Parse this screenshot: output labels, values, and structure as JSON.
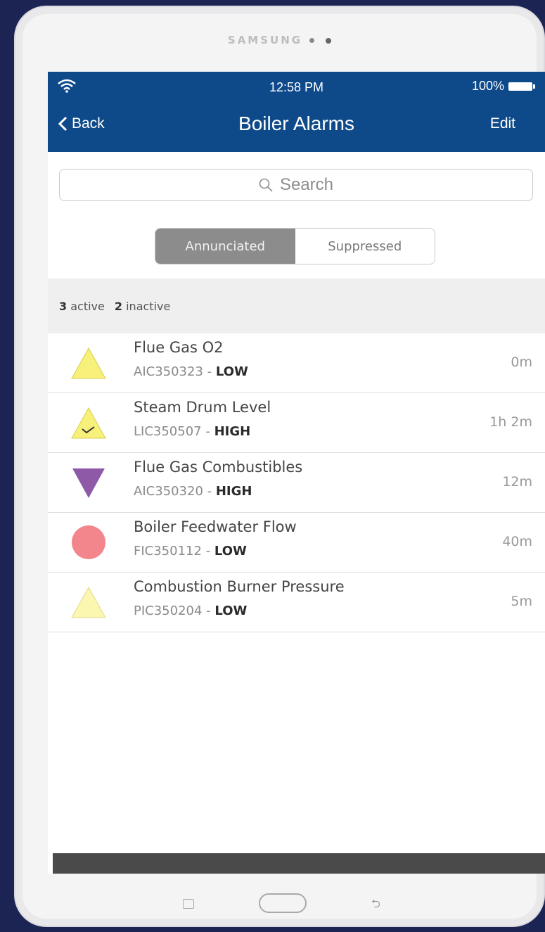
{
  "device": {
    "brand": "SAMSUNG"
  },
  "status_bar": {
    "time": "12:58 PM",
    "battery": "100%"
  },
  "navbar": {
    "back_label": "Back",
    "title": "Boiler Alarms",
    "edit_label": "Edit"
  },
  "search": {
    "placeholder": "Search"
  },
  "segments": {
    "active": "Annunciated",
    "inactive": "Suppressed",
    "selected": "Annunciated"
  },
  "summary": {
    "active_count": "3",
    "active_label": "active",
    "inactive_count": "2",
    "inactive_label": "inactive"
  },
  "alarms": [
    {
      "name": "Flue Gas O2",
      "tag": "AIC350323",
      "level": "LOW",
      "age": "0m",
      "icon": "warning-triangle-icon",
      "color": "#f7f07a"
    },
    {
      "name": "Steam Drum Level",
      "tag": "LIC350507",
      "level": "HIGH",
      "age": "1h 2m",
      "icon": "acknowledged-triangle-icon",
      "color": "#f7f07a"
    },
    {
      "name": "Flue Gas Combustibles",
      "tag": "AIC350320",
      "level": "HIGH",
      "age": "12m",
      "icon": "inverted-triangle-icon",
      "color": "#8e5aa8"
    },
    {
      "name": "Boiler Feedwater Flow",
      "tag": "FIC350112",
      "level": "LOW",
      "age": "40m",
      "icon": "circle-icon",
      "color": "#f2868c"
    },
    {
      "name": "Combustion Burner Pressure",
      "tag": "PIC350204",
      "level": "LOW",
      "age": "5m",
      "icon": "pale-triangle-icon",
      "color": "#fbf6b0"
    }
  ],
  "toolbar": {
    "share_icon": "share-icon"
  },
  "colors": {
    "navbar": "#0e4a8a",
    "toolbar": "#4a4a4a",
    "segment_active": "#8c8c8c"
  }
}
